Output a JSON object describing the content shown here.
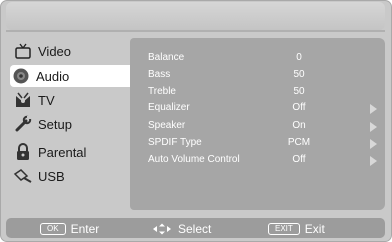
{
  "menu": {
    "items": [
      {
        "label": "Video",
        "icon": "tv-set-icon"
      },
      {
        "label": "Audio",
        "icon": "speaker-icon",
        "active": true
      },
      {
        "label": "TV",
        "icon": "tv-antenna-icon"
      },
      {
        "label": "Setup",
        "icon": "wrench-icon"
      },
      {
        "label": "Parental",
        "icon": "lock-icon"
      },
      {
        "label": "USB",
        "icon": "usb-icon"
      }
    ]
  },
  "settings": {
    "rows": [
      {
        "label": "Balance",
        "value": "0",
        "has_submenu": false
      },
      {
        "label": "Bass",
        "value": "50",
        "has_submenu": false
      },
      {
        "label": "Treble",
        "value": "50",
        "has_submenu": false
      },
      {
        "label": "Equalizer",
        "value": "Off",
        "has_submenu": true
      },
      {
        "label": "Speaker",
        "value": "On",
        "has_submenu": true
      },
      {
        "label": "SPDIF Type",
        "value": "PCM",
        "has_submenu": true
      },
      {
        "label": "Auto Volume Control",
        "value": "Off",
        "has_submenu": true
      }
    ]
  },
  "footer": {
    "enter_key": "OK",
    "enter_label": "Enter",
    "select_label": "Select",
    "exit_key": "EXIT",
    "exit_label": "Exit"
  },
  "colors": {
    "background": "#c9c9c9",
    "panel": "#a6a6a6",
    "active_item": "#ffffff",
    "footer": "#9c9c9c"
  }
}
